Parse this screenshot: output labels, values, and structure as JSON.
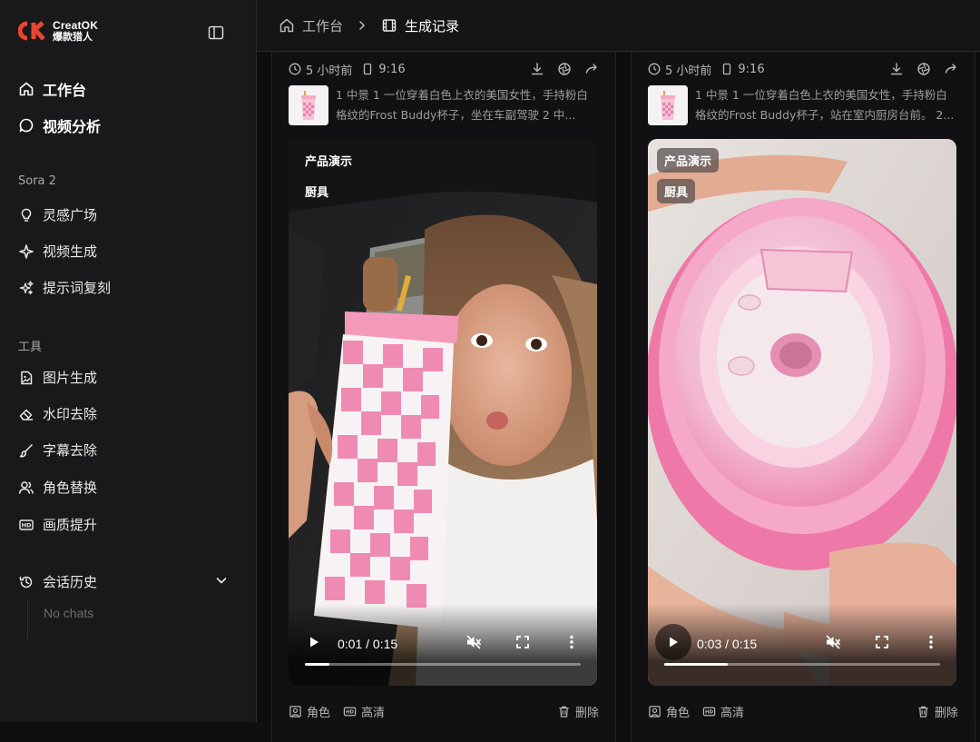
{
  "brand": {
    "name_en": "CreatOK",
    "name_cn": "爆款猎人",
    "colors": {
      "accent": "#e8462f"
    }
  },
  "sidebar": {
    "primary": [
      {
        "label": "工作台",
        "icon": "home-icon"
      },
      {
        "label": "视频分析",
        "icon": "chat-bubble-icon"
      }
    ],
    "sora_section": "Sora 2",
    "sora_items": [
      {
        "label": "灵感广场",
        "icon": "lightbulb-icon"
      },
      {
        "label": "视频生成",
        "icon": "sparkle-icon"
      },
      {
        "label": "提示词复刻",
        "icon": "sparkles-icon"
      }
    ],
    "tools_section": "工具",
    "tool_items": [
      {
        "label": "图片生成",
        "icon": "image-file-icon"
      },
      {
        "label": "水印去除",
        "icon": "eraser-icon"
      },
      {
        "label": "字幕去除",
        "icon": "brush-icon"
      },
      {
        "label": "角色替换",
        "icon": "users-icon"
      },
      {
        "label": "画质提升",
        "icon": "hd-icon"
      }
    ],
    "history": {
      "label": "会话历史",
      "empty": "No chats"
    }
  },
  "breadcrumb": {
    "home": "工作台",
    "current": "生成记录"
  },
  "cards": [
    {
      "time_ago": "5 小时前",
      "ratio": "9:16",
      "prompt": "1 中景 1 一位穿着白色上衣的美国女性，手持粉白格纹的Frost Buddy杯子，坐在车副驾驶 2 中...",
      "tags": [
        "产品演示",
        "厨具"
      ],
      "player": {
        "time": "0:01 / 0:15",
        "progress": 0.09
      },
      "foot": {
        "role": "角色",
        "hd": "高清",
        "delete": "删除"
      }
    },
    {
      "time_ago": "5 小时前",
      "ratio": "9:16",
      "prompt": "1 中景 1 一位穿着白色上衣的美国女性，手持粉白格纹的Frost Buddy杯子，站在室内厨房台前。 2...",
      "tags": [
        "产品演示",
        "厨具"
      ],
      "player": {
        "time": "0:03 / 0:15",
        "progress": 0.23
      },
      "foot": {
        "role": "角色",
        "hd": "高清",
        "delete": "删除"
      }
    }
  ]
}
